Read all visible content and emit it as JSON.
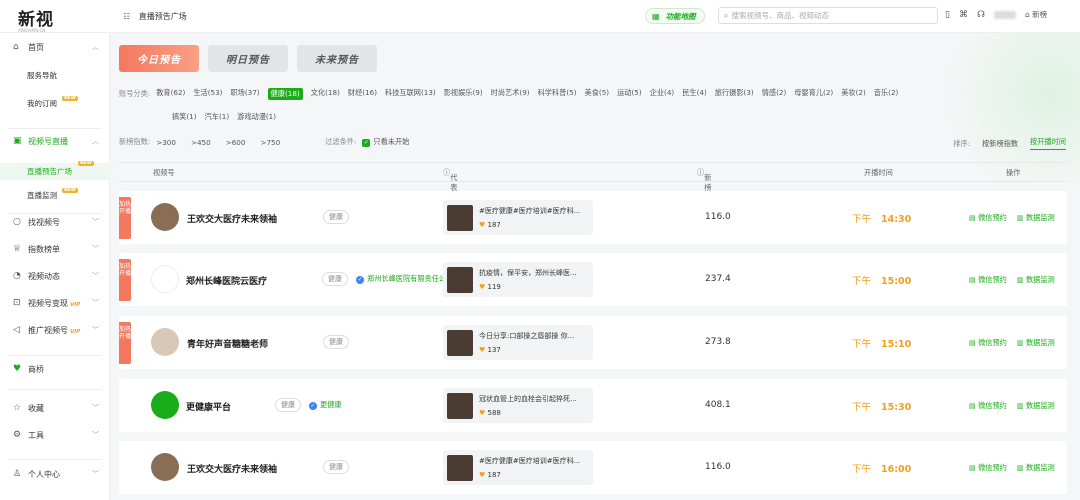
{
  "app": {
    "logo": "新视",
    "logo_sub": "XINSHIPIN.CN"
  },
  "header": {
    "breadcrumb": "直播预告广场",
    "feature_map": "功能地图",
    "search_placeholder": "搜索视频号、商品、视频动态",
    "newrank": "新榜"
  },
  "sidebar": {
    "home": "首页",
    "service_nav": "服务导航",
    "my_subscriptions": "我的订阅",
    "new_badge": "NEW",
    "live": "视频号直播",
    "live_preview": "直播预告广场",
    "live_monitor": "直播监测",
    "find": "找视频号",
    "rank": "指数榜单",
    "dynamic": "视频动态",
    "monetize": "视频号变现",
    "promote": "推广视频号",
    "vip_badge": "VIP",
    "shop": "商桥",
    "favorites": "收藏",
    "tools": "工具",
    "personal": "个人中心"
  },
  "day_tabs": [
    "今日预告",
    "明日预告",
    "未来预告"
  ],
  "filters": {
    "category_label": "账号分类:",
    "categories": [
      "教育(62)",
      "生活(53)",
      "职场(37)",
      "健康(18)",
      "文化(18)",
      "财经(16)",
      "科技互联网(13)",
      "影视娱乐(9)",
      "时尚艺术(9)",
      "科学科普(5)",
      "美食(5)",
      "运动(5)",
      "企业(4)",
      "民生(4)",
      "旅行摄影(3)",
      "情感(2)",
      "母婴育儿(2)",
      "美妆(2)",
      "音乐(2)",
      "搞笑(1)",
      "汽车(1)",
      "游戏动漫(1)"
    ],
    "index_label": "新榜指数:",
    "index_options": [
      ">300",
      ">450",
      ">600",
      ">750"
    ],
    "condition_label": "过滤条件:",
    "only_not_started": "只看未开始",
    "sort_label": "排序:",
    "sort_by_index": "按新榜指数",
    "sort_by_time": "按开播时间"
  },
  "table": {
    "headers": {
      "account": "视频号",
      "work": "代表作品",
      "index": "新榜指数",
      "time": "开播时间",
      "ops": "操作"
    },
    "ribbon": "加热开播",
    "btn_reserve": "微信预约",
    "btn_monitor": "数据监测",
    "rows": [
      {
        "name": "王欢交大医疗未来领袖",
        "tag": "健康",
        "company": "",
        "work_title": "#医疗健康#医疗培训#医疗科...",
        "likes": "187",
        "index": "116.0",
        "period": "下午",
        "time": "14:30",
        "ribbon": true
      },
      {
        "name": "郑州长峰医院云医疗",
        "tag": "健康",
        "company": "郑州长峰医院有限责任公司",
        "work_title": "抗疫情，保平安，郑州长峰医...",
        "likes": "119",
        "index": "237.4",
        "period": "下午",
        "time": "15:00",
        "ribbon": true
      },
      {
        "name": "青年好声音糖糖老师",
        "tag": "健康",
        "company": "",
        "work_title": "今日分享:口部操之唇部操 你...",
        "likes": "137",
        "index": "273.8",
        "period": "下午",
        "time": "15:10",
        "ribbon": true
      },
      {
        "name": "更健康平台",
        "tag": "健康",
        "company": "更健康",
        "work_title": "冠状血管上的血栓会引起猝死...",
        "likes": "588",
        "index": "408.1",
        "period": "下午",
        "time": "15:30",
        "ribbon": false
      },
      {
        "name": "王欢交大医疗未来领袖",
        "tag": "健康",
        "company": "",
        "work_title": "#医疗健康#医疗培训#医疗科...",
        "likes": "187",
        "index": "116.0",
        "period": "下午",
        "time": "16:00",
        "ribbon": false
      }
    ]
  },
  "colors": {
    "brand_green": "#1aad19",
    "accent_orange": "#f4785e",
    "time_orange": "#f0a020"
  }
}
